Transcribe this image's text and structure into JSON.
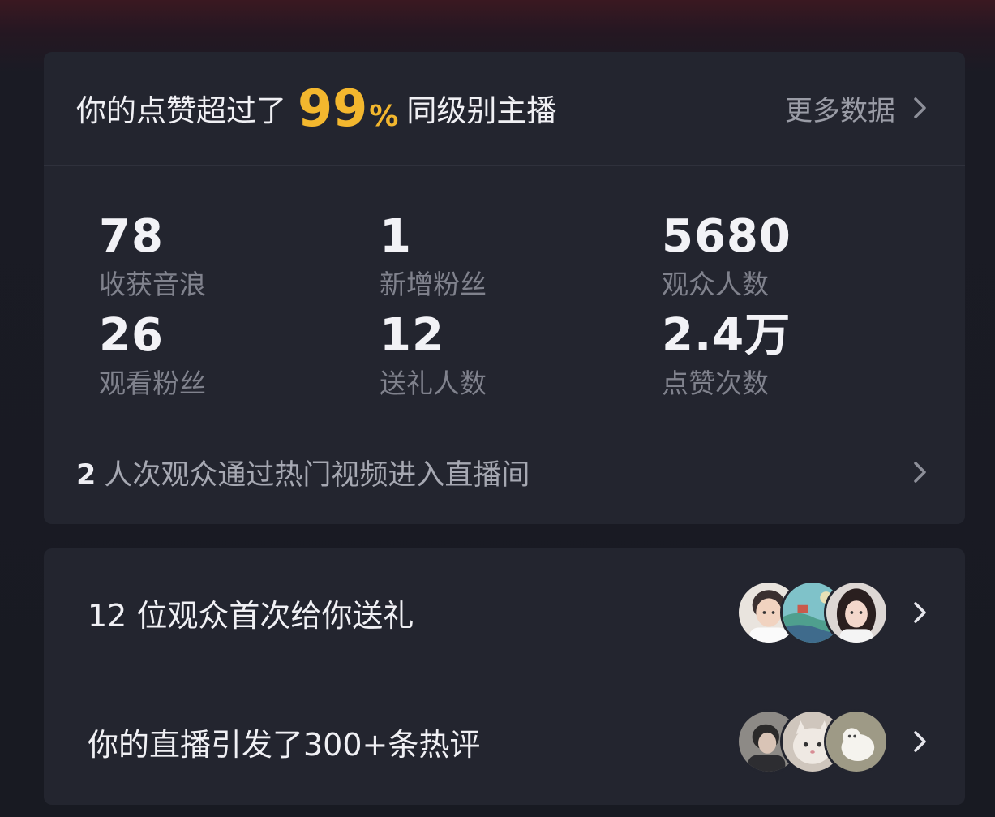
{
  "summary": {
    "prefix": "你的点赞超过了",
    "percent_value": "99",
    "percent_sign": "%",
    "suffix": "同级别主播",
    "more_label": "更多数据"
  },
  "stats": [
    {
      "value": "78",
      "label": "收获音浪"
    },
    {
      "value": "1",
      "label": "新增粉丝"
    },
    {
      "value": "5680",
      "label": "观众人数"
    },
    {
      "value": "26",
      "label": "观看粉丝"
    },
    {
      "value": "12",
      "label": "送礼人数"
    },
    {
      "value": "2.4万",
      "label": "点赞次数"
    }
  ],
  "hot_video": {
    "count": "2",
    "text": "人次观众通过热门视频进入直播间"
  },
  "gifts": {
    "text": "12 位观众首次给你送礼",
    "avatars": [
      "boy-avatar",
      "landscape-avatar",
      "girl-avatar"
    ]
  },
  "comments": {
    "text": "你的直播引发了300+条热评",
    "avatars": [
      "person-avatar",
      "cat-avatar",
      "white-cat-avatar"
    ]
  },
  "colors": {
    "accent": "#f3b72e",
    "card_bg": "#23252f",
    "page_bg": "#181a22",
    "label_gray": "#80828d"
  },
  "icons": {
    "chevron": "chevron-right-icon"
  }
}
